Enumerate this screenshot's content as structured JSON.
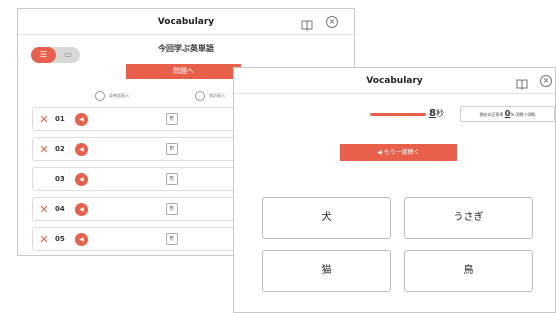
{
  "back_window": {
    "title": "Vocabulary",
    "segment": {
      "list_label": "☰",
      "card_label": "▭"
    },
    "lesson_title": "今回学ぶ英単語",
    "go_button": "問題へ",
    "options": [
      {
        "label": "英単語表示"
      },
      {
        "label": "和訳表示"
      }
    ],
    "rows": [
      {
        "mark": "✕",
        "number": "01",
        "pos": "形"
      },
      {
        "mark": "✕",
        "number": "02",
        "pos": "形"
      },
      {
        "mark": "",
        "number": "03",
        "pos": "形"
      },
      {
        "mark": "✕",
        "number": "04",
        "pos": "形"
      },
      {
        "mark": "✕",
        "number": "05",
        "pos": "形"
      }
    ]
  },
  "front_window": {
    "title": "Vocabulary",
    "timer": {
      "seconds": "8",
      "unit": "秒"
    },
    "score": {
      "label": "現在の正答率",
      "percent": "0",
      "percent_unit": "%",
      "detail": "(0問 / 0問)"
    },
    "replay_button": "◀ もう一度聴く",
    "answers": [
      "犬",
      "うさぎ",
      "猫",
      "鳥"
    ]
  },
  "icons": {
    "book": "book-icon",
    "close": "close-icon",
    "speaker": "speaker-icon"
  },
  "colors": {
    "accent": "#e8604c"
  }
}
